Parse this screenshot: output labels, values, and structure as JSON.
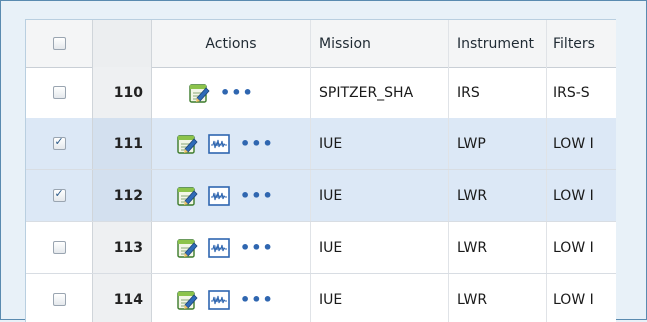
{
  "header": {
    "actions": "Actions",
    "mission": "Mission",
    "instrument": "Instrument",
    "filters": "Filters"
  },
  "rows": [
    {
      "num": "110",
      "mission": "SPITZER_SHA",
      "instrument": "IRS",
      "filters": "IRS-S",
      "checked": false,
      "has_chart": false
    },
    {
      "num": "111",
      "mission": "IUE",
      "instrument": "LWP",
      "filters": "LOW I",
      "checked": true,
      "has_chart": true
    },
    {
      "num": "112",
      "mission": "IUE",
      "instrument": "LWR",
      "filters": "LOW I",
      "checked": true,
      "has_chart": true
    },
    {
      "num": "113",
      "mission": "IUE",
      "instrument": "LWR",
      "filters": "LOW I",
      "checked": false,
      "has_chart": true
    },
    {
      "num": "114",
      "mission": "IUE",
      "instrument": "LWR",
      "filters": "LOW I",
      "checked": false,
      "has_chart": true
    }
  ],
  "icons": {
    "edit": "edit-note-icon",
    "chart": "spectrum-plot-icon",
    "more": "more-options-icon"
  },
  "colors": {
    "selected_row": "#dce8f6",
    "frame_border": "#5a8bb0",
    "more_dots": "#2f66b0"
  }
}
